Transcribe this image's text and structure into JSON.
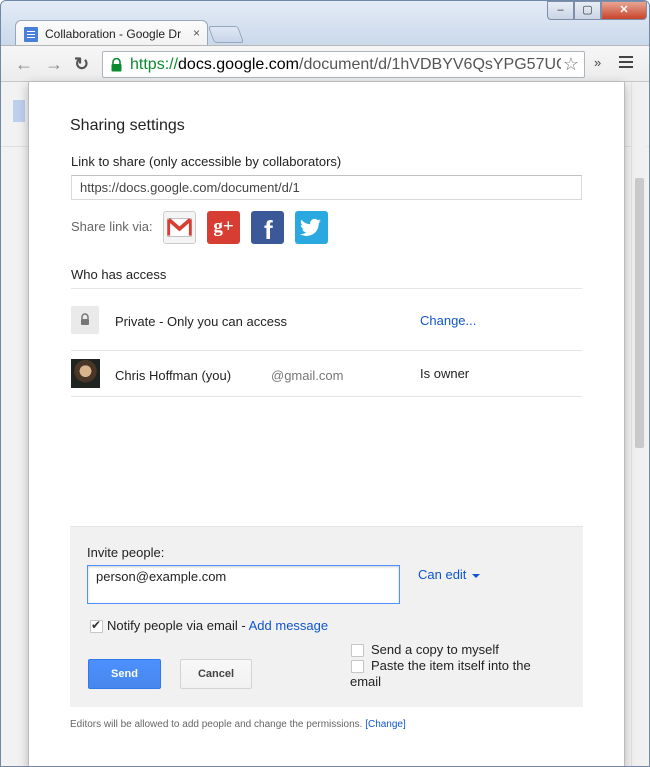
{
  "browser": {
    "tab_title": "Collaboration - Google Dr",
    "tab_close": "×",
    "window_buttons": {
      "minimize": "–",
      "maximize": "▢",
      "close": "✕"
    },
    "back_icon": "←",
    "forward_icon": "→",
    "reload_icon": "↻",
    "url": {
      "scheme": "https://",
      "host": "docs.google.com",
      "path": "/document/d/1hVDBYV6QsYPG57UC"
    },
    "star_icon": "☆",
    "overflow_icon": "»"
  },
  "dialog": {
    "title": "Sharing settings",
    "link_label": "Link to share (only accessible by collaborators)",
    "link_value": "https://docs.google.com/document/d/1",
    "share_via_label": "Share link via:",
    "social": {
      "gplus_text": "g+",
      "facebook_text": "f"
    },
    "who_has_access": "Who has access",
    "access": [
      {
        "name": "Private - Only you can access",
        "action": "Change..."
      },
      {
        "name": "Chris Hoffman (you)",
        "email": "@gmail.com",
        "role": "Is owner"
      }
    ],
    "invite": {
      "label": "Invite people:",
      "value": "person@example.com",
      "permission": "Can edit",
      "notify_label": "Notify people via email - ",
      "add_message": "Add message",
      "send_copy": "Send a copy to myself",
      "paste_item_line1": "Paste the item itself into the",
      "paste_item_line2": "email",
      "send": "Send",
      "cancel": "Cancel"
    },
    "footer": {
      "text": "Editors will be allowed to add people and change the permissions.",
      "change": "[Change]"
    }
  },
  "colors": {
    "accent": "#4d90fe",
    "link": "#1155cc",
    "gplus": "#d73d32",
    "facebook": "#3b5998",
    "twitter": "#2aa9e0"
  }
}
